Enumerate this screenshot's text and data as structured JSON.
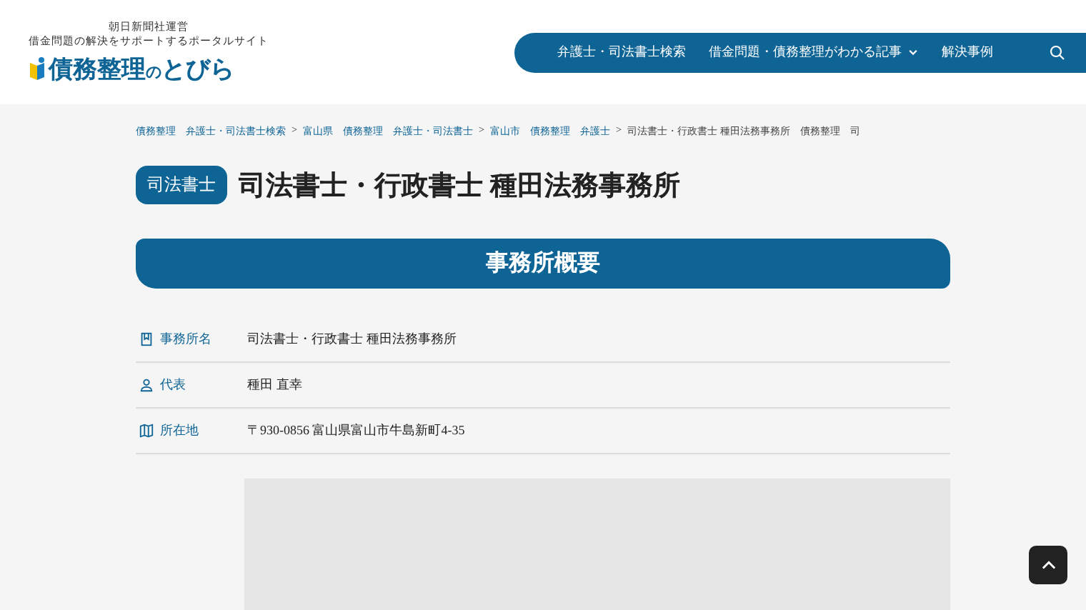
{
  "header": {
    "tagline_1": "朝日新聞社運営",
    "tagline_2": "借金問題の解決をサポートするポータルサイト",
    "logo_main": "債務整理",
    "logo_particle": "の",
    "logo_tail": "とびら"
  },
  "nav": {
    "items": [
      {
        "label": "弁護士・司法書士検索",
        "dropdown": false
      },
      {
        "label": "借金問題・債務整理がわかる記事",
        "dropdown": true
      },
      {
        "label": "解決事例",
        "dropdown": false
      }
    ]
  },
  "breadcrumb": [
    {
      "text": "債務整理　弁護士・司法書士検索",
      "kind": "link"
    },
    {
      "text": ">",
      "kind": "separator"
    },
    {
      "text": "富山県　債務整理　弁護士・司法書士",
      "kind": "link"
    },
    {
      "text": ">",
      "kind": "separator"
    },
    {
      "text": "富山市　債務整理　弁護士",
      "kind": "link"
    },
    {
      "text": ">",
      "kind": "separator"
    },
    {
      "text": "司法書士・行政書士 種田法務事務所　債務整理　司",
      "kind": "current"
    }
  ],
  "title": {
    "badge": "司法書士",
    "name": "司法書士・行政書士 種田法務事務所"
  },
  "section": {
    "heading": "事務所概要",
    "rows": [
      {
        "kind": "office",
        "label": "事務所名",
        "value": "司法書士・行政書士 種田法務事務所"
      },
      {
        "kind": "person",
        "label": "代表",
        "value": "種田 直幸"
      },
      {
        "kind": "map",
        "label": "所在地",
        "value": "〒930-0856 富山県富山市牛島新町4-35"
      }
    ]
  }
}
